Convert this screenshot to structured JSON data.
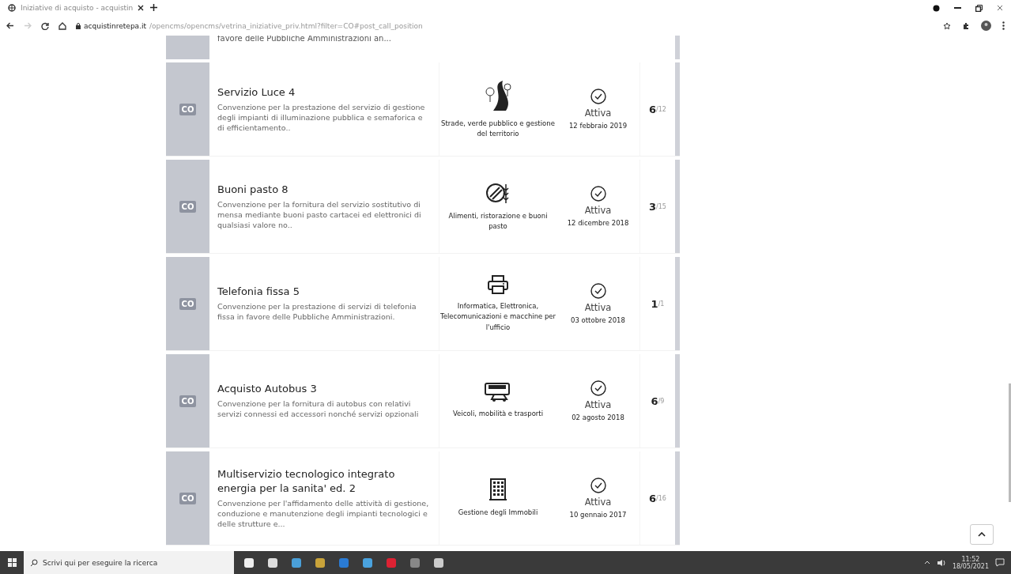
{
  "browser": {
    "tab_title": "Iniziative di acquisto - acquistin",
    "url_host": "acquistinretepa.it",
    "url_path": "/opencms/opencms/vetrina_iniziative_priv.html?filter=CO#post_call_position"
  },
  "partial_row": {
    "description": "favore delle Pubbliche Amministrazioni an..."
  },
  "rows": [
    {
      "badge": "CO",
      "title": "Servizio Luce 4",
      "description": "Convenzione per la prestazione del servizio di gestione degli impianti di illuminazione pubblica e semaforica e di efficientamento..",
      "category": "Strade, verde pubblico e gestione del territorio",
      "kind": "roads",
      "status": "Attiva",
      "date": "12 febbraio 2019",
      "count": "6",
      "total": "/12"
    },
    {
      "badge": "CO",
      "title": "Buoni pasto 8",
      "description": "Convenzione per la fornitura del servizio sostitutivo di mensa mediante buoni pasto cartacei ed elettronici di qualsiasi valore no..",
      "category": "Alimenti, ristorazione e buoni pasto",
      "kind": "food",
      "status": "Attiva",
      "date": "12 dicembre 2018",
      "count": "3",
      "total": "/15"
    },
    {
      "badge": "CO",
      "title": "Telefonia fissa 5",
      "description": "Convenzione per la prestazione di servizi di telefonia fissa in favore delle Pubbliche Amministrazioni.",
      "category": "Informatica, Elettronica, Telecomunicazioni e macchine per l'ufficio",
      "kind": "office",
      "status": "Attiva",
      "date": "03 ottobre 2018",
      "count": "1",
      "total": "/1"
    },
    {
      "badge": "CO",
      "title": "Acquisto Autobus 3",
      "description": "Convenzione per la fornitura di autobus con relativi servizi connessi ed accessori nonché servizi opzionali",
      "category": "Veicoli, mobilità e trasporti",
      "kind": "vehicles",
      "status": "Attiva",
      "date": "02 agosto 2018",
      "count": "6",
      "total": "/9"
    },
    {
      "badge": "CO",
      "title": "Multiservizio tecnologico integrato energia per la sanita' ed. 2",
      "description": "Convenzione per l'affidamento delle attività di gestione, conduzione e manutenzione degli impianti tecnologici e delle strutture e...",
      "category": "Gestione degli Immobili",
      "kind": "buildings",
      "status": "Attiva",
      "date": "10 gennaio 2017",
      "count": "6",
      "total": "/16"
    }
  ],
  "taskbar": {
    "search_placeholder": "Scrivi qui per eseguire la ricerca",
    "time": "11:52",
    "date": "18/05/2021"
  }
}
